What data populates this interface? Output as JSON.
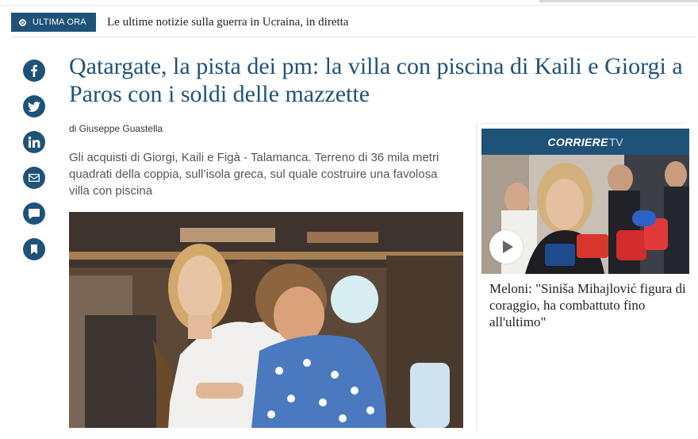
{
  "ticker": {
    "badge_label": "ULTIMA ORA",
    "headline": "Le ultime notizie sulla guerra in Ucraina, in diretta"
  },
  "share": {
    "icons": [
      "facebook-icon",
      "twitter-icon",
      "linkedin-icon",
      "mail-icon",
      "comment-icon",
      "bookmark-icon"
    ]
  },
  "article": {
    "title": "Qatargate, la pista dei pm: la villa con piscina di Kaili e Giorgi a Paros con i soldi delle mazzette",
    "byline": "di Giuseppe Guastella",
    "summary": "Gli acquisti di Giorgi, Kaili e Figà - Talamanca. Terreno di 36 mila metri quadrati della coppia, sull’isola greca, sul quale costruire una favolosa villa con piscina"
  },
  "sidebar": {
    "tv_brand_primary": "CORRIERE",
    "tv_brand_secondary": "TV",
    "video_title": "Meloni: \"Siniša Mihajlović figura di coraggio, ha combattuto fino all'ultimo\""
  },
  "colors": {
    "brand_blue": "#1f5279",
    "text": "#222222",
    "summary_text": "#555555"
  }
}
